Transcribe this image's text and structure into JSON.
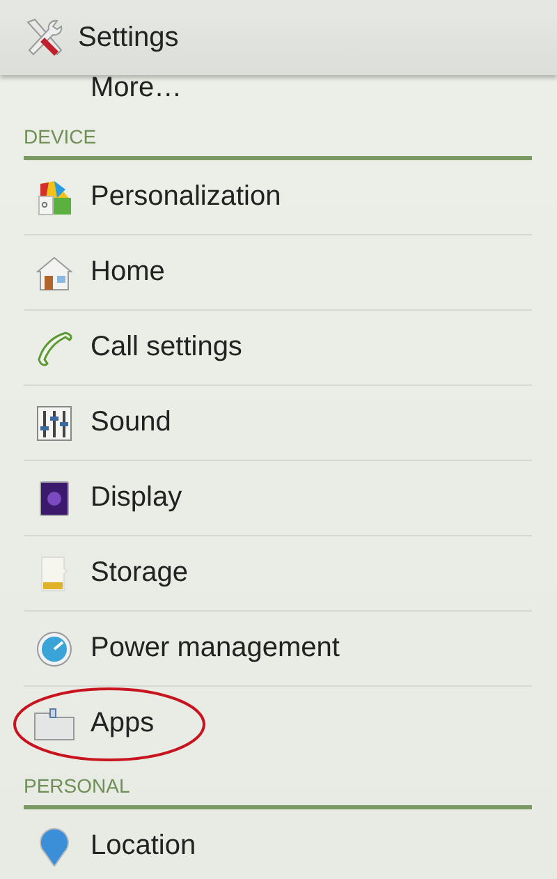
{
  "title": "Settings",
  "partial_item": {
    "label": "More…"
  },
  "sections": [
    {
      "header": "DEVICE",
      "items": [
        {
          "label": "Personalization",
          "kind": "palette",
          "highlighted": false
        },
        {
          "label": "Home",
          "kind": "house",
          "highlighted": false
        },
        {
          "label": "Call settings",
          "kind": "phone",
          "highlighted": false
        },
        {
          "label": "Sound",
          "kind": "sliders",
          "highlighted": false
        },
        {
          "label": "Display",
          "kind": "display",
          "highlighted": false
        },
        {
          "label": "Storage",
          "kind": "sdcard",
          "highlighted": false
        },
        {
          "label": "Power management",
          "kind": "gauge",
          "highlighted": false
        },
        {
          "label": "Apps",
          "kind": "folder",
          "highlighted": true
        }
      ]
    },
    {
      "header": "PERSONAL",
      "items": [
        {
          "label": "Location",
          "kind": "pin",
          "highlighted": false
        }
      ]
    }
  ]
}
